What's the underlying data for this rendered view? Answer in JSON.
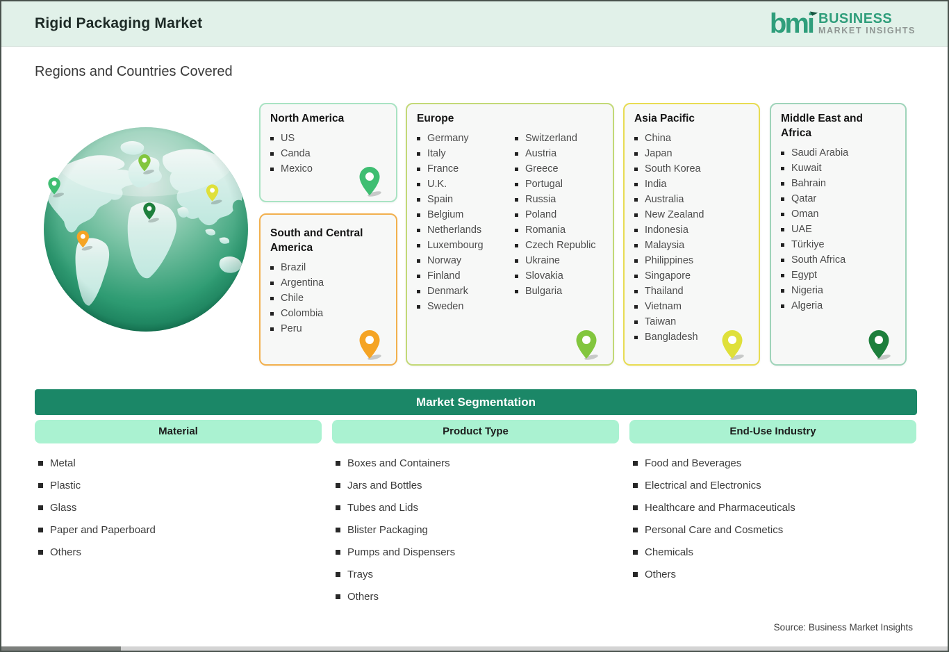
{
  "header": {
    "title": "Rigid Packaging Market",
    "logo": {
      "mark": "bmi",
      "line1": "BUSINESS",
      "line2": "MARKET  INSIGHTS"
    }
  },
  "section_title": "Regions and Countries Covered",
  "colors": {
    "header_bg": "#e1f1e9",
    "seg_bar_bg": "#1b8767",
    "seg_header_bg": "#aaf2d1",
    "page_border": "#49524d"
  },
  "regions": [
    {
      "name": "North America",
      "accent": "#3fbe72",
      "border": "#a9e3c3",
      "countries": [
        "US",
        "Canda",
        "Mexico"
      ]
    },
    {
      "name": "South and Central America",
      "accent": "#f5a424",
      "border": "#f2b04e",
      "countries": [
        "Brazil",
        "Argentina",
        "Chile",
        "Colombia",
        "Peru"
      ]
    },
    {
      "name": "Europe",
      "accent": "#82c63e",
      "border": "#c3d977",
      "countries": [
        "Germany",
        "Italy",
        "France",
        "U.K.",
        "Spain",
        "Belgium",
        "Netherlands",
        "Luxembourg",
        "Norway",
        "Finland",
        "Denmark",
        "Sweden",
        "Switzerland",
        "Austria",
        "Greece",
        "Portugal",
        "Russia",
        "Poland",
        "Romania",
        "Czech Republic",
        "Ukraine",
        "Slovakia",
        "Bulgaria"
      ]
    },
    {
      "name": "Asia Pacific",
      "accent": "#dfe03a",
      "border": "#e8dc52",
      "countries": [
        "China",
        "Japan",
        "South Korea",
        "India",
        "Australia",
        "New Zealand",
        "Indonesia",
        "Malaysia",
        "Philippines",
        "Singapore",
        "Thailand",
        "Vietnam",
        "Taiwan",
        "Bangladesh"
      ]
    },
    {
      "name": "Middle East and Africa",
      "accent": "#1d7f3c",
      "border": "#9fd4ba",
      "countries": [
        "Saudi Arabia",
        "Kuwait",
        "Bahrain",
        "Qatar",
        "Oman",
        "UAE",
        "Türkiye",
        "South Africa",
        "Egypt",
        "Nigeria",
        "Algeria"
      ]
    }
  ],
  "segmentation": {
    "title": "Market Segmentation",
    "columns": [
      {
        "header": "Material",
        "items": [
          "Metal",
          "Plastic",
          "Glass",
          "Paper and Paperboard",
          "Others"
        ]
      },
      {
        "header": "Product Type",
        "items": [
          "Boxes and Containers",
          "Jars and Bottles",
          "Tubes and Lids",
          "Blister Packaging",
          "Pumps and Dispensers",
          "Trays",
          "Others"
        ]
      },
      {
        "header": "End-Use Industry",
        "items": [
          "Food and Beverages",
          "Electrical and Electronics",
          "Healthcare and Pharmaceuticals",
          "Personal Care and Cosmetics",
          "Chemicals",
          "Others"
        ]
      }
    ]
  },
  "source": "Source: Business Market Insights"
}
